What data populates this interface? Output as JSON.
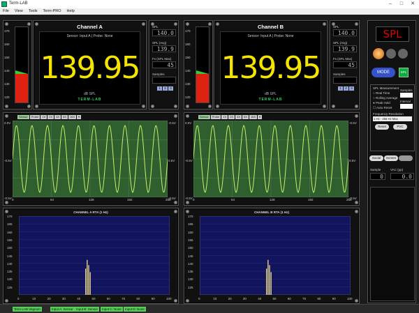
{
  "window": {
    "title": "Term-LAB",
    "minimize": "–",
    "maximize": "□",
    "close": "✕"
  },
  "menu": [
    "File",
    "View",
    "Tools",
    "Term-PRO",
    "Help"
  ],
  "channels": [
    {
      "title": "Channel A",
      "sensor": "Sensor: Input A | Probe: None",
      "value": "139.95",
      "unit": "dB SPL",
      "logo": "TERM-LAB",
      "spl": "140.0",
      "spl_avg": "139.9",
      "fx_max": "45",
      "samples": "",
      "buttons": [
        "1",
        "2",
        "3"
      ],
      "rta_title": "CHANNEL A RTA (1 Hz)"
    },
    {
      "title": "Channel B",
      "sensor": "Sensor: Input A | Probe: None",
      "value": "139.95",
      "unit": "dB SPL",
      "logo": "TERM-LAB",
      "spl": "140.0",
      "spl_avg": "139.9",
      "fx_max": "45",
      "samples": "",
      "buttons": [
        "1",
        "2",
        "3"
      ],
      "rta_title": "CHANNEL B RTA (1 Hz)"
    }
  ],
  "labels": {
    "spl": "SPL",
    "spl_avg": "SPL (Avg)",
    "fx_max": "Fx (SPL Max)",
    "samples": "Samples"
  },
  "meter": {
    "ticks": [
      "170",
      "160",
      "150",
      "140",
      "130",
      "120"
    ],
    "level": 0.62,
    "green_marker": 0.66
  },
  "scope": {
    "tabs": [
      "Sensor",
      "Probe",
      "1X",
      "2X",
      "4X",
      "8X",
      "16X",
      "▾"
    ],
    "active_tab": "Sensor",
    "y_ticks_left": [
      "0.0V",
      "-0.5V",
      "-0.5V"
    ],
    "y_ticks_right": [
      "-0.5V",
      "0.5V",
      "-0.5V"
    ],
    "x_ticks": [
      "0",
      "64",
      "128",
      "192",
      "256"
    ],
    "cycles": 10
  },
  "rta": {
    "y_ticks": [
      "170",
      "165",
      "160",
      "155",
      "150",
      "145",
      "140",
      "135",
      "130",
      "125"
    ],
    "x_ticks": [
      "0",
      "10",
      "20",
      "30",
      "40",
      "50",
      "60",
      "70",
      "80",
      "90",
      "100"
    ],
    "peak_hz": 45,
    "peak_db": 145
  },
  "right": {
    "spl_display": "SPL",
    "mode_label": "MODE",
    "mode_badge": "SPL",
    "measure_title": "SPL Measurement",
    "options": [
      "Real Time",
      "Rolling Average",
      "Peak Hold"
    ],
    "selected_option": "Peak Hold",
    "auto_reset": "Auto Reset",
    "samples_label": "Samples",
    "samples_value": "",
    "interval_label": "Interval",
    "interval_value": "",
    "freq_res_label": "Frequency Resolution",
    "freq_res_value": "1 Hz - 256 Hz Max",
    "reset_label": "Reset",
    "pvc_label": "PVC",
    "social": "Social",
    "screen": "Screen",
    "extra": "",
    "sample_label": "Sample",
    "vac_label": "VAC (pp)",
    "sample_value": "0",
    "vac_value": "0.0"
  },
  "status": [
    "Term-LAB Vegnum",
    "Input A: Sensor",
    "Input B: Sensor",
    "Input C: None",
    "Input D: None"
  ],
  "colors": {
    "value": "#f5e400",
    "scope_bg": "#2f5e2f",
    "wave": "#c8f06a",
    "rta_bg": "#12145e",
    "peak": "#f0e08a"
  }
}
